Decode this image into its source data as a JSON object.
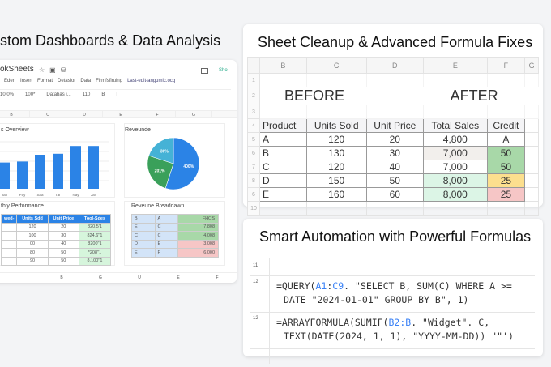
{
  "left": {
    "title": "stom Dashboards & Data Analysis",
    "app_name": "okSheets",
    "share": "Sho",
    "menu": [
      "Eden",
      "Insert",
      "Format",
      "Detaslor",
      "Data",
      "Firmfsfiruing",
      "Last-edit-angumic.ocg"
    ],
    "toolbar": [
      "10.0%",
      "100*",
      "Databas i...",
      "110",
      "B",
      "I"
    ],
    "col_headers": [
      "B",
      "C",
      "D",
      "E",
      "F",
      "G"
    ],
    "bottom_col_headers": [
      "B",
      "G",
      "U",
      "E",
      "F"
    ],
    "bar_chart": {
      "title": "s Overview"
    },
    "pie_chart": {
      "title": "Reveunde"
    },
    "perf": {
      "title": "thly Performance",
      "headers": [
        "wed-",
        "Units Sdd",
        "Unit Price",
        "Tool-Sdes"
      ],
      "rows": [
        [
          "",
          "120",
          "20",
          "820.5'1"
        ],
        [
          "",
          "100",
          "30",
          "824.6''1"
        ],
        [
          "",
          "00",
          "40",
          "8200''1"
        ],
        [
          "",
          "80",
          "50",
          "*208''1"
        ],
        [
          "",
          "90",
          "50",
          "8.100''1"
        ]
      ]
    },
    "breakdown": {
      "title": "Reveune Breaddawn",
      "rows": [
        [
          "B",
          "A",
          "FHOS"
        ],
        [
          "E",
          "C",
          "7,808"
        ],
        [
          "C",
          "C",
          "4,008"
        ],
        [
          "D",
          "E",
          "3,008"
        ],
        [
          "E",
          "F",
          "6,000"
        ]
      ]
    }
  },
  "chart_data": [
    {
      "type": "bar",
      "title": "s Overview",
      "categories": [
        "Jan",
        "Pay",
        "Saa",
        "Tar",
        "Nay",
        "Jan"
      ],
      "values": [
        27,
        28,
        35,
        36,
        44,
        44
      ],
      "ylim": [
        0,
        50
      ]
    },
    {
      "type": "pie",
      "title": "Reveunde",
      "labels": [
        "400%",
        "201%",
        "30%"
      ],
      "values": [
        55,
        25,
        20
      ],
      "colors": [
        "#2b83e6",
        "#3aa05a",
        "#45b2d6"
      ]
    }
  ],
  "cleanup": {
    "title": "Sheet Cleanup &  Advanced Formula Fixes",
    "before": "BEFORE",
    "after": "AFTER",
    "col_headers": [
      "B",
      "C",
      "D",
      "E",
      "F",
      "G"
    ],
    "row_numbers": [
      "1",
      "2",
      "3",
      "4",
      "5",
      "6",
      "7",
      "8",
      "6",
      "10"
    ],
    "headers": [
      "Product",
      "Units Sold",
      "Unit Price",
      "Total Sales",
      "Credit"
    ],
    "rows": [
      [
        "A",
        "120",
        "20",
        "4,800",
        "A"
      ],
      [
        "B",
        "130",
        "30",
        "7,000",
        "50"
      ],
      [
        "C",
        "120",
        "40",
        "7,000",
        "50"
      ],
      [
        "D",
        "150",
        "50",
        "8,000",
        "25"
      ],
      [
        "E",
        "160",
        "60",
        "8,000",
        "25"
      ]
    ]
  },
  "automation": {
    "title": "Smart Automation with Powerful Formulas",
    "row_numbers": [
      "11",
      "12",
      "12"
    ],
    "f1": {
      "a": "=QUERY(",
      "r1": "A1",
      "c": ":",
      "r2": "C9",
      "b": ". \"SELECT B, SUM(C) WHERE A >=",
      "line2": "DATE \"2024-01-01\" GROUP BY B\", 1)"
    },
    "f2": {
      "a": "=ARRAYFORMULA(SUMIF(",
      "r1": "B2:B",
      "b": ". \"Widget\". C,",
      "line2": "TEXT(DATE(2024, 1, 1), \"YYYY-MM-DD)) \"\"')"
    }
  }
}
